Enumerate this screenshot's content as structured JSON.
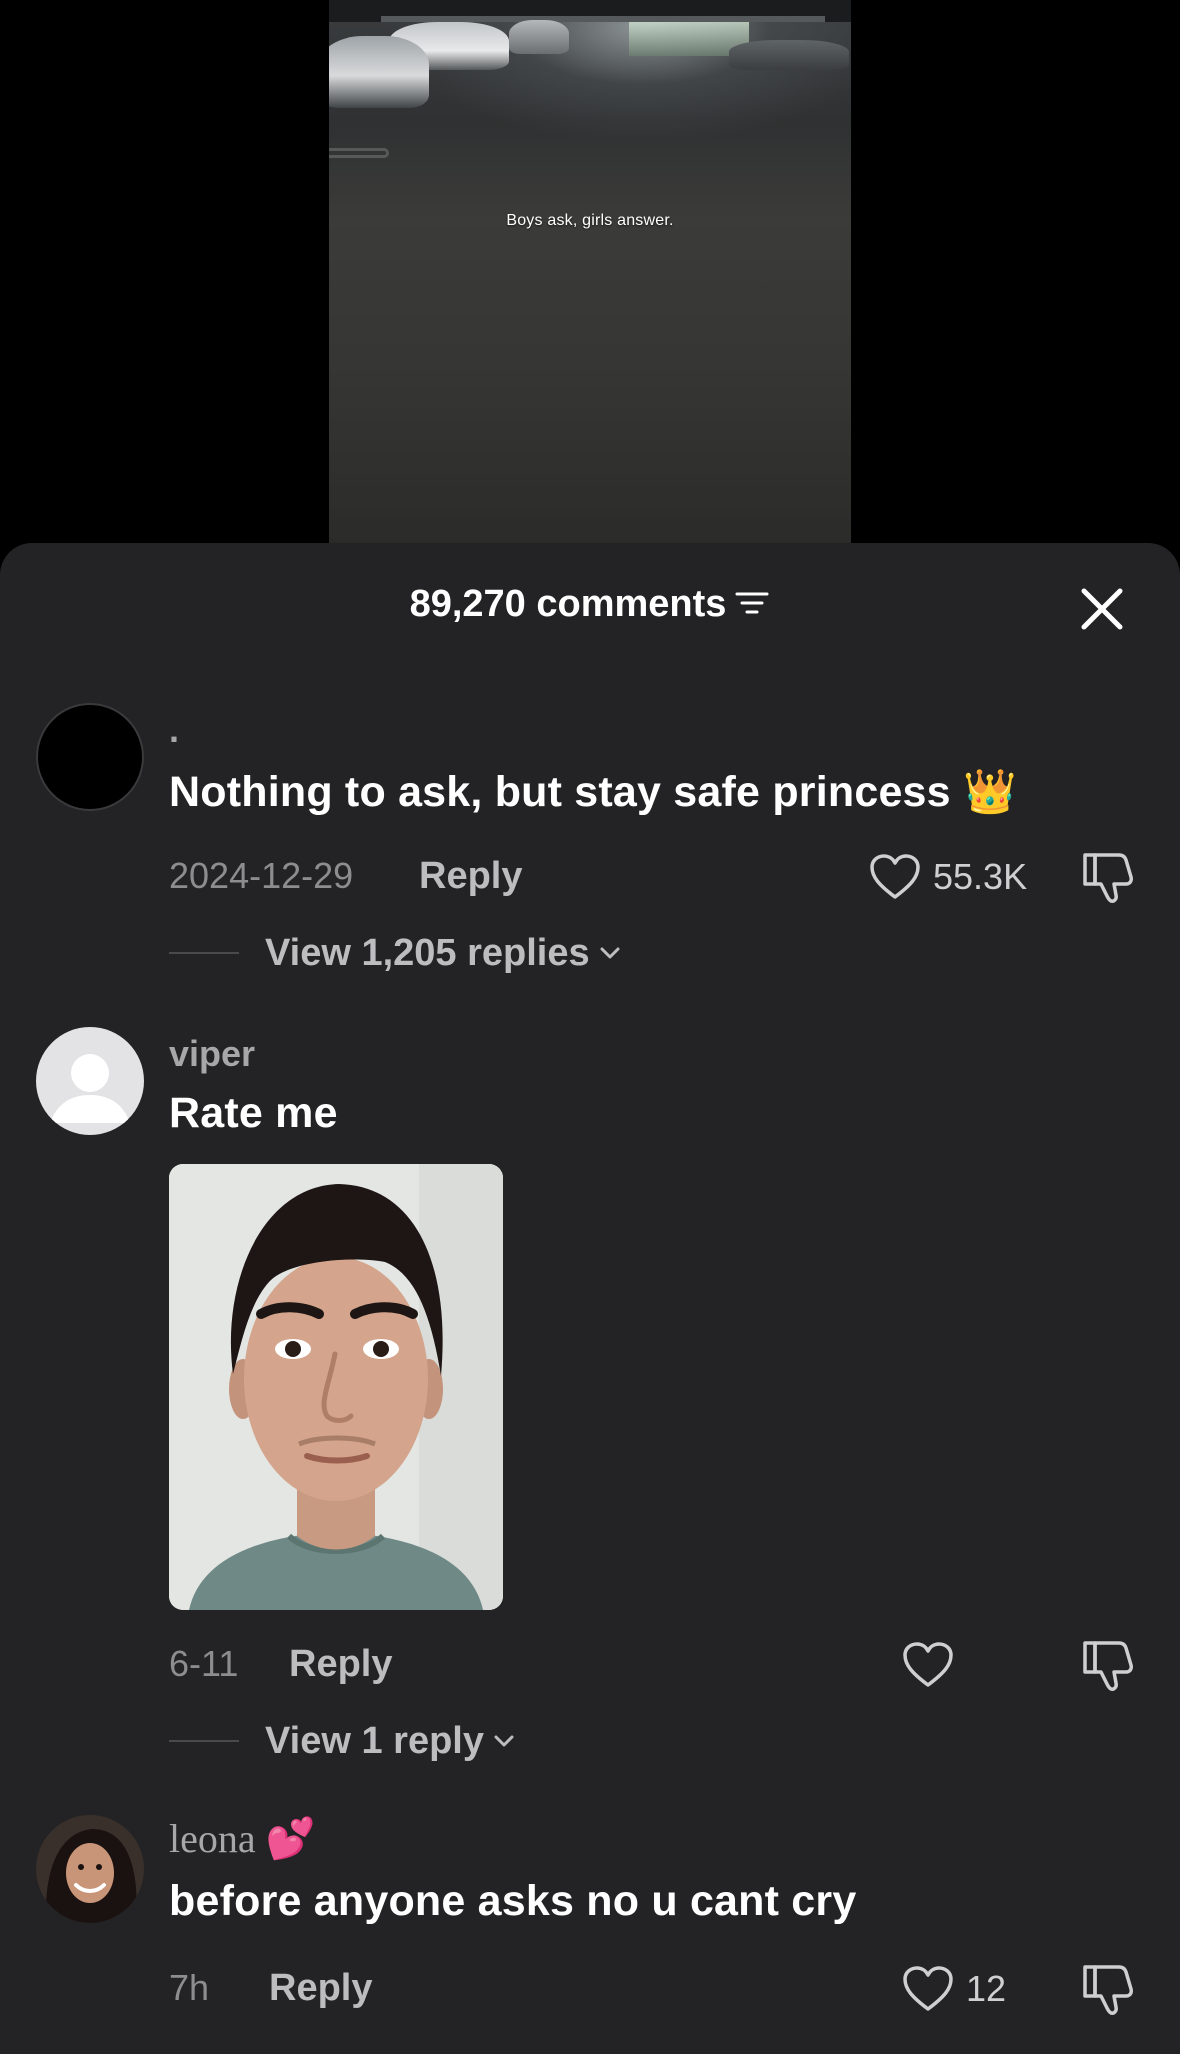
{
  "video": {
    "caption": "Boys ask, girls answer."
  },
  "sheet": {
    "count_label": "89,270 comments",
    "filter_icon": "filter-icon",
    "close_icon": "close-icon"
  },
  "comments": [
    {
      "username": ".",
      "text": "Nothing to ask, but stay safe princess",
      "emoji": "👑",
      "date": "2024-12-29",
      "reply_label": "Reply",
      "likes": "55.3K",
      "view_replies": "View 1,205 replies"
    },
    {
      "username": "viper",
      "text": "Rate me",
      "date": "6-11",
      "reply_label": "Reply",
      "likes": "",
      "view_replies": "View 1 reply"
    },
    {
      "username": "leona",
      "username_emoji": "💕",
      "text": "before anyone asks no u cant cry",
      "date": "7h",
      "reply_label": "Reply",
      "likes": "12"
    }
  ],
  "colors": {
    "sheet_bg": "#232325",
    "text_primary": "#ffffff",
    "text_secondary": "#a7a7a9"
  }
}
